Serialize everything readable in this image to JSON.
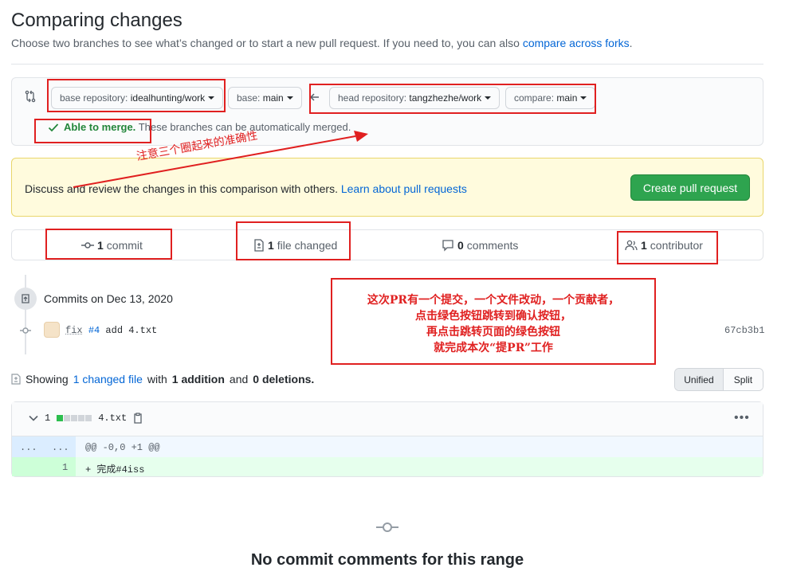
{
  "page": {
    "title": "Comparing changes",
    "subtitle": "Choose two branches to see what’s changed or to start a new pull request. If you need to, you can also",
    "subtitle_link": "compare across forks",
    "subtitle_end": "."
  },
  "range": {
    "base_repo_label": "base repository:",
    "base_repo_value": "idealhunting/work",
    "base_label": "base:",
    "base_value": "main",
    "head_repo_label": "head repository:",
    "head_repo_value": "tangzhezhe/work",
    "compare_label": "compare:",
    "compare_value": "main",
    "merge_ok": "Able to merge.",
    "merge_text": "These branches can be automatically merged."
  },
  "flash": {
    "text": "Discuss and review the changes in this comparison with others.",
    "link": "Learn about pull requests",
    "button": "Create pull request"
  },
  "stats": {
    "commits_count": "1",
    "commits_label": "commit",
    "files_count": "1",
    "files_label": "file changed",
    "comments_count": "0",
    "comments_label": "comments",
    "contributors_count": "1",
    "contributors_label": "contributor"
  },
  "commits": {
    "date_label": "Commits on Dec 13, 2020",
    "message_prefix": "fix",
    "message_issue": "#4",
    "message_rest": "add 4.txt",
    "sha": "67cb3b1"
  },
  "summary": {
    "showing": "Showing",
    "changed_link": "1 changed file",
    "with": "with",
    "additions": "1 addition",
    "and": "and",
    "deletions": "0 deletions.",
    "unified": "Unified",
    "split": "Split"
  },
  "file": {
    "changes": "1",
    "name": "4.txt",
    "hunk_dots_left": "...",
    "hunk_dots_right": "...",
    "hunk_header": "@@ -0,0 +1 @@",
    "line_number": "1",
    "line_text": "+ 完成#4iss"
  },
  "blank": {
    "title": "No commit comments for this range"
  },
  "annotations": {
    "italic_note": "注意三个圈起来的准确性",
    "box_line1": "这次PR有一个提交，一个文件改动，一个贡献者，",
    "box_line2": "点击绿色按钮跳转到确认按钮，",
    "box_line3": "再点击跳转页面的绿色按钮",
    "box_line4": "就完成本次“提PR”工作"
  },
  "colors": {
    "accent": "#0366d6",
    "green": "#2ea44f",
    "annotation_red": "#e02020"
  }
}
